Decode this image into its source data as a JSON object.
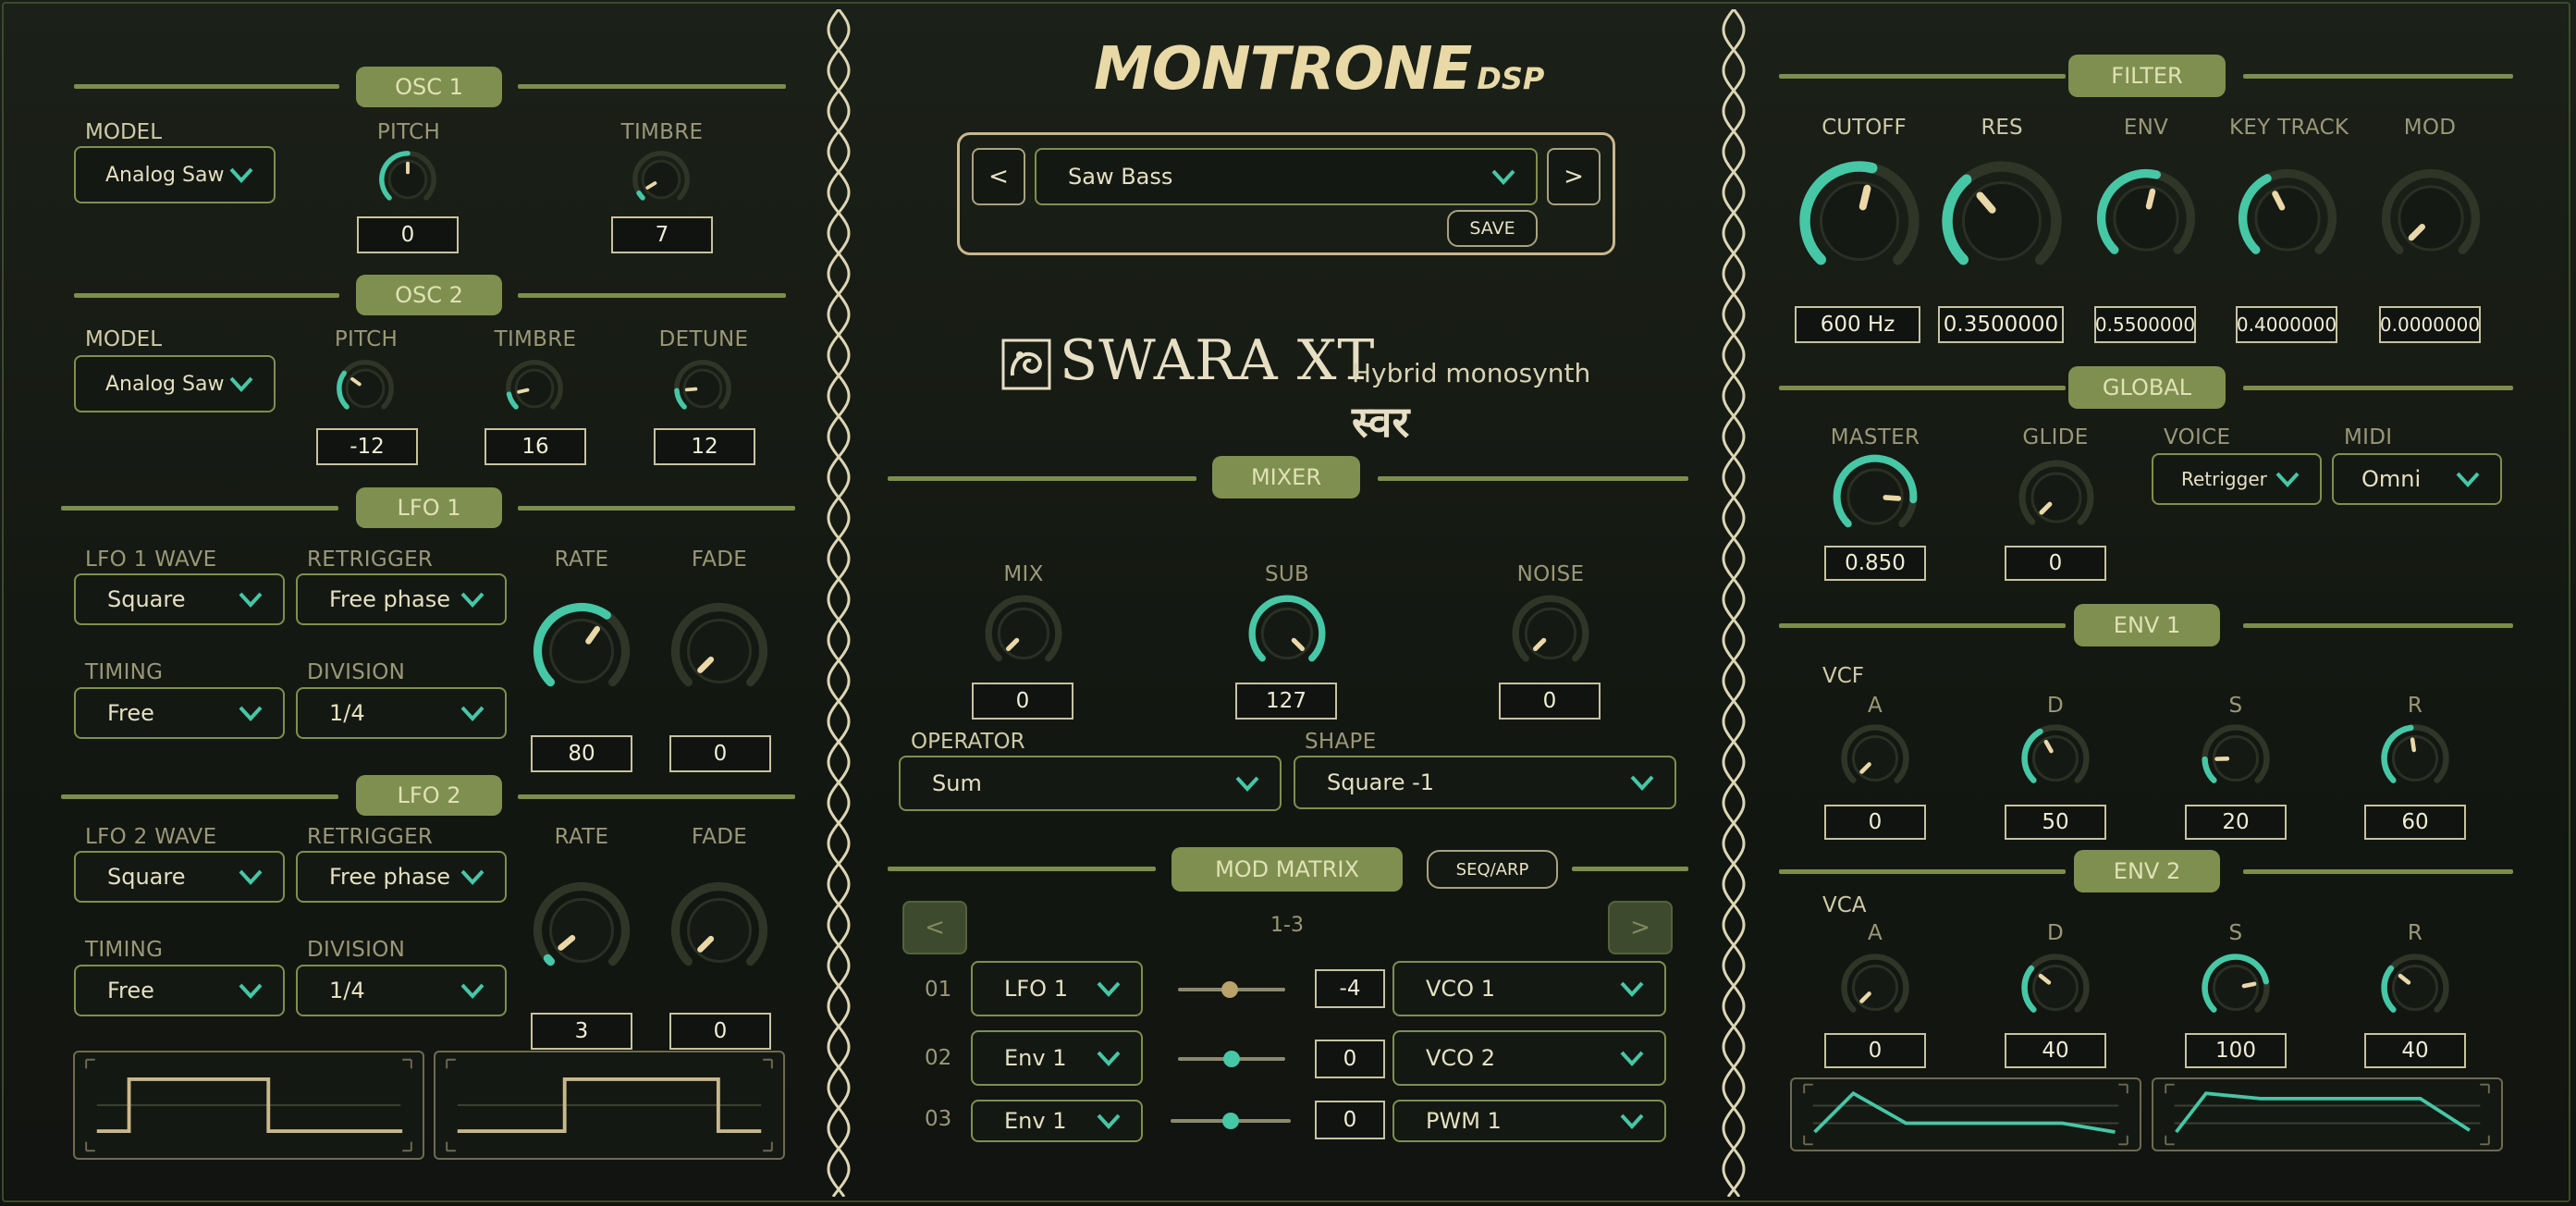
{
  "colors": {
    "accent": "#46c7a6",
    "panel": "#7f8f4f",
    "cream": "#c9b78c",
    "bg": "#141813"
  },
  "brand": {
    "logo": "MONTRONE",
    "logo_suffix": "DSP",
    "product": "SWARA XT",
    "subtitle": "Hybrid monosynth",
    "devanagari": "स्वर"
  },
  "preset": {
    "name": "Saw Bass",
    "prev": "<",
    "next": ">",
    "save": "SAVE"
  },
  "osc1": {
    "title": "OSC 1",
    "model_label": "MODEL",
    "model": "Analog Saw",
    "pitch_label": "PITCH",
    "pitch": "0",
    "timbre_label": "TIMBRE",
    "timbre": "7"
  },
  "osc2": {
    "title": "OSC 2",
    "model_label": "MODEL",
    "model": "Analog Saw",
    "pitch_label": "PITCH",
    "pitch": "-12",
    "timbre_label": "TIMBRE",
    "timbre": "16",
    "detune_label": "DETUNE",
    "detune": "12"
  },
  "lfo1": {
    "title": "LFO 1",
    "wave_label": "LFO 1 WAVE",
    "wave": "Square",
    "retrig_label": "RETRIGGER",
    "retrig": "Free phase",
    "timing_label": "TIMING",
    "timing": "Free",
    "division_label": "DIVISION",
    "division": "1/4",
    "rate_label": "RATE",
    "rate": "80",
    "fade_label": "FADE",
    "fade": "0"
  },
  "lfo2": {
    "title": "LFO 2",
    "wave_label": "LFO 2 WAVE",
    "wave": "Square",
    "retrig_label": "RETRIGGER",
    "retrig": "Free phase",
    "timing_label": "TIMING",
    "timing": "Free",
    "division_label": "DIVISION",
    "division": "1/4",
    "rate_label": "RATE",
    "rate": "3",
    "fade_label": "FADE",
    "fade": "0"
  },
  "mixer": {
    "title": "MIXER",
    "mix_label": "MIX",
    "mix": "0",
    "sub_label": "SUB",
    "sub": "127",
    "noise_label": "NOISE",
    "noise": "0",
    "operator_label": "OPERATOR",
    "operator": "Sum",
    "shape_label": "SHAPE",
    "shape": "Square -1"
  },
  "modmatrix": {
    "title": "MOD MATRIX",
    "seq_tab": "SEQ/ARP",
    "page": "1-3",
    "prev": "<",
    "next": ">",
    "rows": [
      {
        "num": "01",
        "source": "LFO 1",
        "amount": "-4",
        "dest": "VCO 1"
      },
      {
        "num": "02",
        "source": "Env 1",
        "amount": "0",
        "dest": "VCO 2"
      },
      {
        "num": "03",
        "source": "Env 1",
        "amount": "0",
        "dest": "PWM 1"
      }
    ]
  },
  "filter": {
    "title": "FILTER",
    "cutoff_label": "CUTOFF",
    "cutoff": "600 Hz",
    "res_label": "RES",
    "res": "0.3500000",
    "env_label": "ENV",
    "env": "0.5500000",
    "key_label": "KEY TRACK",
    "key": "0.4000000",
    "mod_label": "MOD",
    "mod": "0.0000000"
  },
  "global": {
    "title": "GLOBAL",
    "master_label": "MASTER",
    "master": "0.850",
    "glide_label": "GLIDE",
    "glide": "0",
    "voice_label": "VOICE",
    "voice": "Retrigger",
    "midi_label": "MIDI",
    "midi": "Omni"
  },
  "env1": {
    "title": "ENV 1",
    "target": "VCF",
    "a_label": "A",
    "a": "0",
    "d_label": "D",
    "d": "50",
    "s_label": "S",
    "s": "20",
    "r_label": "R",
    "r": "60"
  },
  "env2": {
    "title": "ENV 2",
    "target": "VCA",
    "a_label": "A",
    "a": "0",
    "d_label": "D",
    "d": "40",
    "s_label": "S",
    "s": "100",
    "r_label": "R",
    "r": "40"
  },
  "knob_levels": {
    "osc1_pitch": 0.5,
    "osc1_timbre": 0.05,
    "osc2_pitch": 0.3,
    "osc2_timbre": 0.12,
    "osc2_detune": 0.15,
    "lfo1_rate": 0.63,
    "lfo1_fade": 0,
    "lfo2_rate": 0.02,
    "lfo2_fade": 0,
    "mix": 0,
    "sub": 1,
    "noise": 0,
    "cutoff": 0.55,
    "res": 0.35,
    "env": 0.55,
    "key_track": 0.4,
    "mod": 0,
    "master": 0.85,
    "glide": 0,
    "env1_a": 0,
    "env1_d": 0.39,
    "env1_s": 0.16,
    "env1_r": 0.47,
    "env2_a": 0,
    "env2_d": 0.31,
    "env2_s": 0.79,
    "env2_r": 0.31
  },
  "mod_amount_levels": [
    -0.04,
    0,
    0
  ]
}
